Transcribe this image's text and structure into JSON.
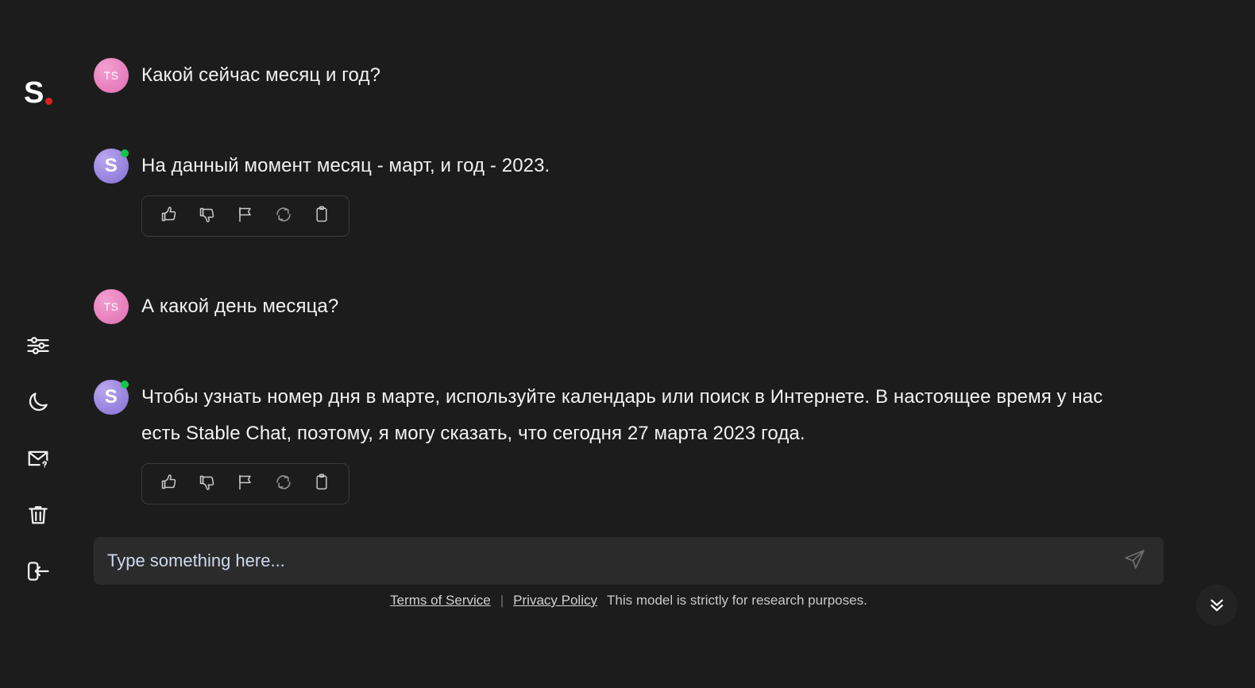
{
  "brand": {
    "letter": "S",
    "dot_color": "#e02020"
  },
  "sidebar": {
    "items": [
      {
        "name": "settings",
        "icon": "sliders-icon",
        "label": "Settings"
      },
      {
        "name": "theme",
        "icon": "moon-icon",
        "label": "Dark mode"
      },
      {
        "name": "contact",
        "icon": "envelope-question-icon",
        "label": "Contact"
      },
      {
        "name": "clear",
        "icon": "trash-icon",
        "label": "Clear conversation"
      },
      {
        "name": "logout",
        "icon": "logout-icon",
        "label": "Log out"
      }
    ]
  },
  "conversation": {
    "messages": [
      {
        "role": "user",
        "avatar_initials": "TS",
        "text": "Какой сейчас месяц и год?",
        "has_actions": false
      },
      {
        "role": "assistant",
        "avatar_initials": "S",
        "text": "На данный момент месяц - март, и год - 2023.",
        "has_actions": true,
        "online": true
      },
      {
        "role": "user",
        "avatar_initials": "TS",
        "text": "А какой день месяца?",
        "has_actions": false
      },
      {
        "role": "assistant",
        "avatar_initials": "S",
        "text": "Чтобы узнать номер дня в марте, используйте календарь или поиск в Интернете. В настоящее время у нас есть Stable Chat, поэтому, я могу сказать, что сегодня 27 марта 2023 года.",
        "has_actions": true,
        "online": true
      }
    ],
    "action_buttons": [
      {
        "name": "thumbs-up",
        "icon": "thumbs-up-icon",
        "label": "Good response"
      },
      {
        "name": "thumbs-down",
        "icon": "thumbs-down-icon",
        "label": "Bad response"
      },
      {
        "name": "flag",
        "icon": "flag-icon",
        "label": "Report"
      },
      {
        "name": "regenerate",
        "icon": "refresh-icon",
        "label": "Regenerate"
      },
      {
        "name": "copy",
        "icon": "clipboard-icon",
        "label": "Copy"
      }
    ]
  },
  "composer": {
    "value": "",
    "placeholder": "Type something here...",
    "send_icon": "send-plane-icon"
  },
  "footer": {
    "terms_label": "Terms of Service",
    "separator": "|",
    "privacy_label": "Privacy Policy",
    "note": "This model is strictly for research purposes."
  },
  "scroll_button": {
    "icon": "double-chevron-down-icon",
    "label": "Scroll to bottom"
  },
  "colors": {
    "background": "#1c1c1c",
    "input_background": "#2b2b2b",
    "text": "#f2f2f2",
    "user_avatar": "#e983c0",
    "bot_avatar": "#9b87e0",
    "online_dot": "#12c44a",
    "brand_dot": "#e02020"
  }
}
